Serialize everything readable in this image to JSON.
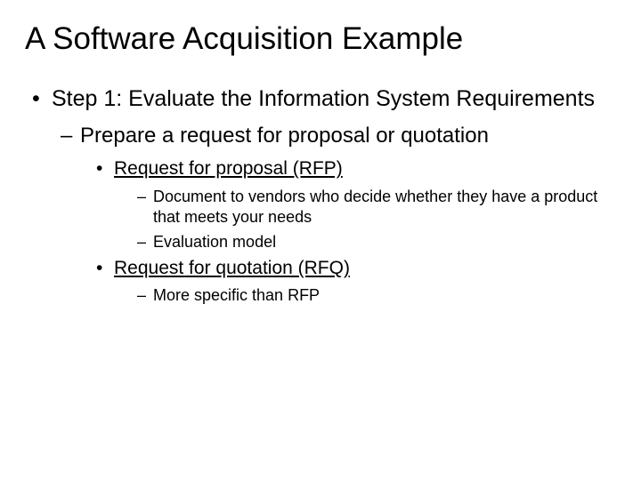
{
  "title": "A Software Acquisition Example",
  "l1": {
    "bullet": "•",
    "text": "Step 1: Evaluate the Information System Requirements"
  },
  "l2": {
    "dash": "–",
    "text": "Prepare a request for proposal or quotation"
  },
  "l3a": {
    "bullet": "•",
    "text": "Request for proposal (RFP)"
  },
  "l4a": {
    "dash": "–",
    "text": "Document to vendors who decide whether they have a product that meets your needs"
  },
  "l4b": {
    "dash": "–",
    "text": "Evaluation model"
  },
  "l3b": {
    "bullet": "•",
    "text": "Request for quotation (RFQ)"
  },
  "l4c": {
    "dash": "–",
    "text": "More specific than RFP"
  }
}
